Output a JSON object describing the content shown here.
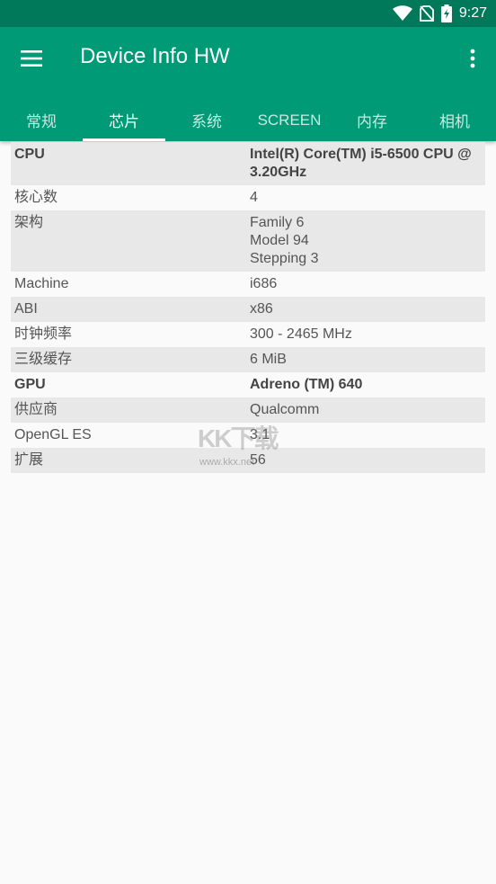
{
  "status_bar": {
    "time": "9:27",
    "icons": [
      "wifi-icon",
      "no-sim-icon",
      "battery-charging-icon"
    ]
  },
  "app_bar": {
    "title": "Device Info HW",
    "menu_icon": "hamburger-menu-icon",
    "overflow_icon": "more-vert-icon"
  },
  "tabs": [
    {
      "label": "常规"
    },
    {
      "label": "芯片"
    },
    {
      "label": "系统"
    },
    {
      "label": "SCREEN"
    },
    {
      "label": "内存"
    },
    {
      "label": "相机"
    }
  ],
  "active_tab": "芯片",
  "rows": [
    {
      "key": "CPU",
      "value": "Intel(R) Core(TM) i5-6500 CPU @ 3.20GHz",
      "bold": true,
      "shaded": true
    },
    {
      "key": "核心数",
      "value": "4",
      "bold": false,
      "shaded": false
    },
    {
      "key": "架构",
      "value": "Family 6\nModel 94\nStepping 3",
      "bold": false,
      "shaded": true
    },
    {
      "key": "Machine",
      "value": "i686",
      "bold": false,
      "shaded": false
    },
    {
      "key": "ABI",
      "value": "x86",
      "bold": false,
      "shaded": true
    },
    {
      "key": "时钟频率",
      "value": "300 - 2465 MHz",
      "bold": false,
      "shaded": false
    },
    {
      "key": "三级缓存",
      "value": "6 MiB",
      "bold": false,
      "shaded": true
    },
    {
      "key": "GPU",
      "value": "Adreno (TM) 640",
      "bold": true,
      "shaded": false
    },
    {
      "key": "供应商",
      "value": "Qualcomm",
      "bold": false,
      "shaded": true
    },
    {
      "key": "OpenGL ES",
      "value": "3.1",
      "bold": false,
      "shaded": false
    },
    {
      "key": "扩展",
      "value": "56",
      "bold": false,
      "shaded": true
    }
  ],
  "watermark": {
    "logo": "KK下载",
    "url": "www.kkx.net"
  },
  "colors": {
    "status_bar": "#00785a",
    "app_bar": "#009b76",
    "row_shade": "#e8e8e8",
    "background": "#fafafa"
  }
}
